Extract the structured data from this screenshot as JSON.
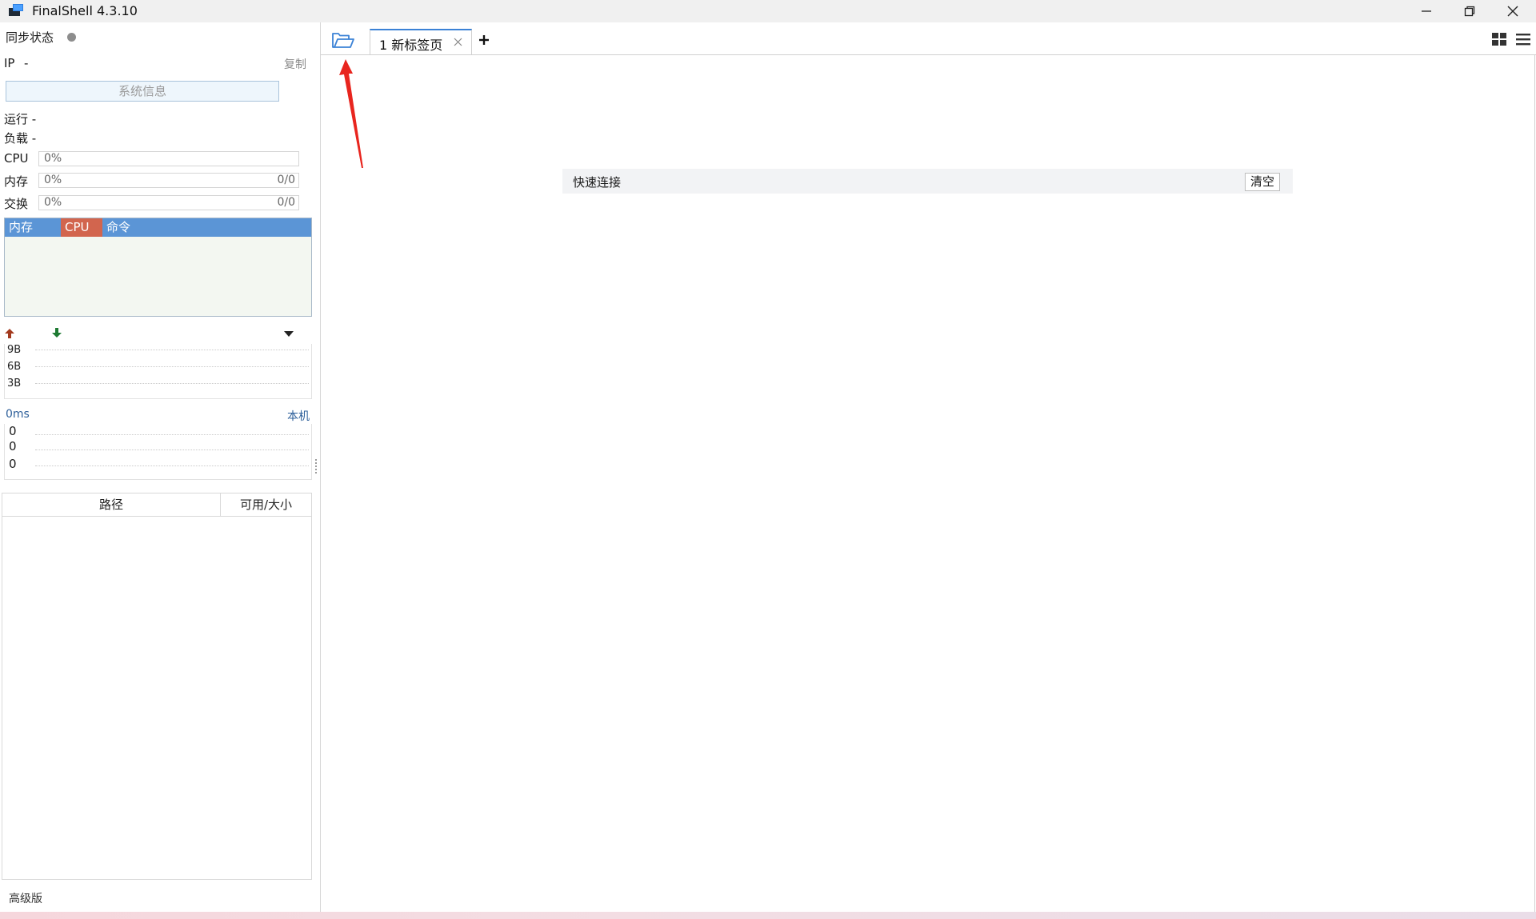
{
  "window": {
    "title": "FinalShell 4.3.10"
  },
  "sidebar": {
    "sync_label": "同步状态",
    "ip_label": "IP",
    "ip_value": "-",
    "copy_label": "复制",
    "sysinfo_button": "系统信息",
    "uptime_label": "运行 -",
    "load_label": "负载 -",
    "cpu": {
      "label": "CPU",
      "percent": "0%"
    },
    "mem": {
      "label": "内存",
      "percent": "0%",
      "usage": "0/0"
    },
    "swap": {
      "label": "交换",
      "percent": "0%",
      "usage": "0/0"
    },
    "process_tabs": [
      "内存",
      "CPU",
      "命令"
    ],
    "net_ticks": [
      "9B",
      "6B",
      "3B"
    ],
    "latency": {
      "value": "0ms",
      "host": "本机",
      "rows": [
        "0",
        "0",
        "0"
      ]
    },
    "disk_columns": [
      "路径",
      "可用/大小"
    ],
    "edition": "高级版"
  },
  "tabs": {
    "active_label": "1 新标签页"
  },
  "main": {
    "quick_connect_label": "快速连接",
    "clear_button": "清空"
  },
  "colors": {
    "accent": "#3b82d6",
    "proc_header": "#5b95d6",
    "cpu_tab": "#d2654e",
    "upload_arrow": "#a33a1e",
    "download_arrow": "#1e7a32",
    "annotation_arrow": "#e8251e"
  }
}
